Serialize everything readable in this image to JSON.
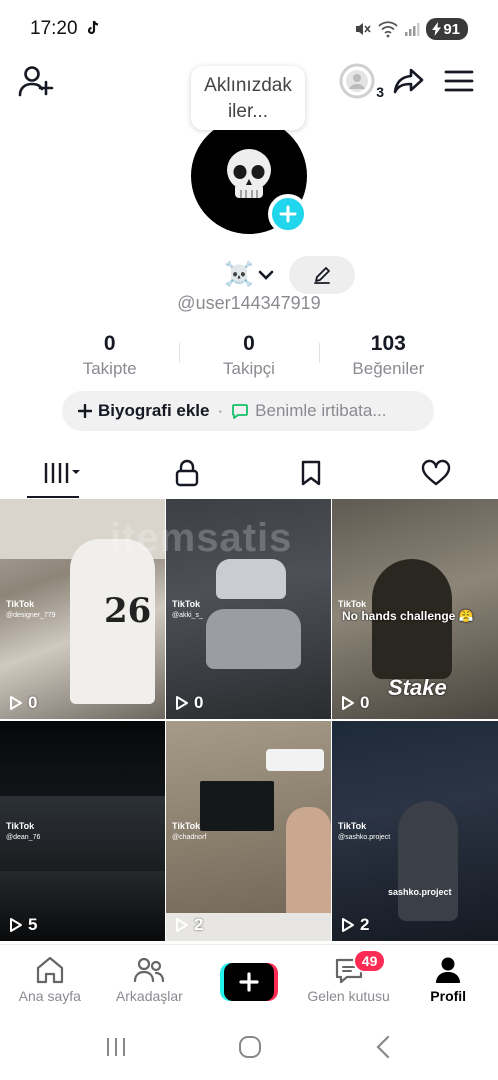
{
  "status_bar": {
    "time": "17:20",
    "battery": "91",
    "tiktok_icon": "tiktok-logo-icon",
    "mute_icon": "mute-icon",
    "wifi_icon": "wifi-icon",
    "signal_icon": "signal-icon"
  },
  "header": {
    "add_friend_icon": "add-friend-icon",
    "story_count": "3",
    "share_icon": "share-arrow-icon",
    "menu_icon": "hamburger-menu-icon"
  },
  "profile": {
    "note": "Aklınızdak iler...",
    "avatar_icon": "skull-icon",
    "display_name": "☠️",
    "username": "@user144347919",
    "stats": [
      {
        "value": "0",
        "label": "Takipte"
      },
      {
        "value": "0",
        "label": "Takipçi"
      },
      {
        "value": "103",
        "label": "Beğeniler"
      }
    ],
    "bio_add": "Biyografi ekle",
    "bio_separator": "·",
    "contact": "Benimle irtibata..."
  },
  "tabs": [
    {
      "icon": "videos-grid-icon",
      "active": true
    },
    {
      "icon": "lock-icon",
      "active": false
    },
    {
      "icon": "bookmark-icon",
      "active": false
    },
    {
      "icon": "heart-icon",
      "active": false
    }
  ],
  "watermark": "itemsatis",
  "videos": [
    {
      "views": "0",
      "tiktok_mark": "TikTok",
      "handle": "@designer_779",
      "jersey": "26"
    },
    {
      "views": "0",
      "tiktok_mark": "TikTok",
      "handle": "@akki_s_"
    },
    {
      "views": "0",
      "tiktok_mark": "TikTok",
      "overlay": "No hands challenge 😤",
      "brand": "Stake"
    },
    {
      "views": "5",
      "tiktok_mark": "TikTok",
      "handle": "@dean_76"
    },
    {
      "views": "2",
      "tiktok_mark": "TikTok",
      "handle": "@chadnorf"
    },
    {
      "views": "2",
      "tiktok_mark": "TikTok",
      "handle": "@sashko.project",
      "caption": "sashko.project"
    }
  ],
  "bottom_nav": [
    {
      "label": "Ana sayfa",
      "icon": "home-icon"
    },
    {
      "label": "Arkadaşlar",
      "icon": "friends-icon"
    },
    {
      "label": "",
      "icon": "plus-icon"
    },
    {
      "label": "Gelen kutusu",
      "icon": "inbox-icon",
      "badge": "49"
    },
    {
      "label": "Profil",
      "icon": "profile-icon",
      "active": true
    }
  ],
  "colors": {
    "accent_cyan": "#25f4ee",
    "accent_red": "#fe2c55",
    "avatar_plus": "#20d5ec",
    "contact_green": "#14c06a"
  }
}
